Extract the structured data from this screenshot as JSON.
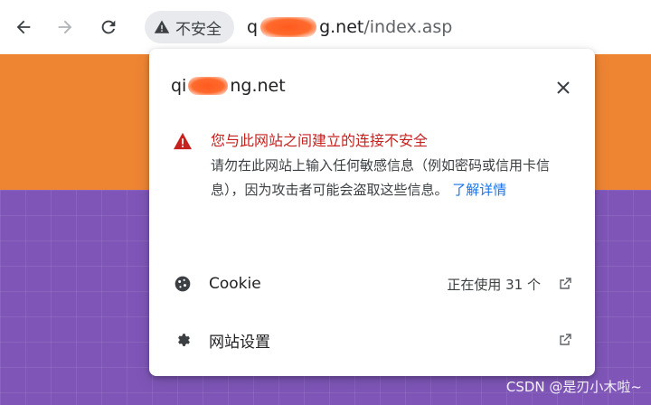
{
  "browser": {
    "security_label": "不安全",
    "url_prefix": "q",
    "url_host_end": "g.net",
    "url_path": "/index.asp"
  },
  "popup": {
    "site_prefix": "qi",
    "site_suffix": "ng.net",
    "warning_heading": "您与此网站之间建立的连接不安全",
    "warning_body": "请勿在此网站上输入任何敏感信息（例如密码或信用卡信息），因为攻击者可能会盗取这些信息。",
    "learn_more": "了解详情",
    "cookie_label": "Cookie",
    "cookie_status": "正在使用 31 个",
    "site_settings_label": "网站设置"
  },
  "watermark": "CSDN @是刃小木啦~",
  "colors": {
    "warning_red": "#c5221f",
    "link_blue": "#1a73e8",
    "orange_band": "#ee8533",
    "purple_band": "#7f56b8"
  }
}
